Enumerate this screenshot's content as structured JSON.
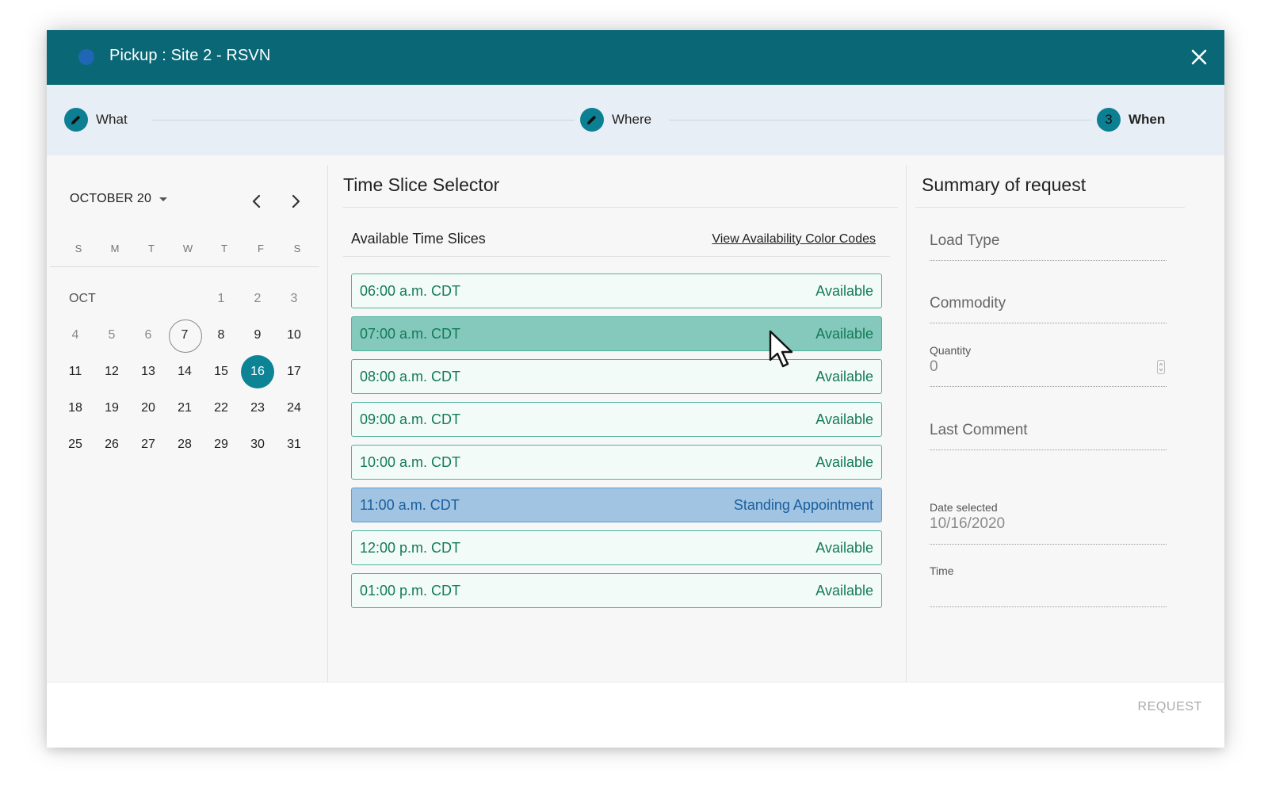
{
  "dialog": {
    "title": "Pickup : Site 2 - RSVN",
    "accent_color": "#0a6876",
    "dot_color": "#1f66b5"
  },
  "stepper": {
    "steps": [
      {
        "label": "What",
        "badge": "",
        "icon": "pencil-icon"
      },
      {
        "label": "Where",
        "badge": "",
        "icon": "pencil-icon"
      },
      {
        "label": "When",
        "badge": "3",
        "icon": ""
      }
    ]
  },
  "calendar": {
    "month_label": "OCTOBER 20",
    "weekdays": [
      "S",
      "M",
      "T",
      "W",
      "T",
      "F",
      "S"
    ],
    "month_short": "OCT",
    "today": "7",
    "selected": "16",
    "days": [
      "1",
      "2",
      "3",
      "4",
      "5",
      "6",
      "7",
      "8",
      "9",
      "10",
      "11",
      "12",
      "13",
      "14",
      "15",
      "16",
      "17",
      "18",
      "19",
      "20",
      "21",
      "22",
      "23",
      "24",
      "25",
      "26",
      "27",
      "28",
      "29",
      "30",
      "31"
    ]
  },
  "time_slices": {
    "title": "Time Slice Selector",
    "subtitle": "Available Time Slices",
    "color_codes_link": "View Availability Color Codes",
    "slices": [
      {
        "time": "06:00 a.m. CDT",
        "status": "Available",
        "kind": "available"
      },
      {
        "time": "07:00 a.m. CDT",
        "status": "Available",
        "kind": "hover"
      },
      {
        "time": "08:00 a.m. CDT",
        "status": "Available",
        "kind": "available"
      },
      {
        "time": "09:00 a.m. CDT",
        "status": "Available",
        "kind": "available"
      },
      {
        "time": "10:00 a.m. CDT",
        "status": "Available",
        "kind": "available"
      },
      {
        "time": "11:00 a.m. CDT",
        "status": "Standing Appointment",
        "kind": "standing"
      },
      {
        "time": "12:00 p.m. CDT",
        "status": "Available",
        "kind": "available"
      },
      {
        "time": "01:00 p.m. CDT",
        "status": "Available",
        "kind": "available"
      }
    ]
  },
  "summary": {
    "title": "Summary of request",
    "load_type_placeholder": "Load Type",
    "commodity_placeholder": "Commodity",
    "quantity_label": "Quantity",
    "quantity_value": "0",
    "last_comment_placeholder": "Last Comment",
    "date_label": "Date selected",
    "date_value": "10/16/2020",
    "time_label": "Time",
    "time_value": ""
  },
  "footer": {
    "request_label": "REQUEST"
  }
}
